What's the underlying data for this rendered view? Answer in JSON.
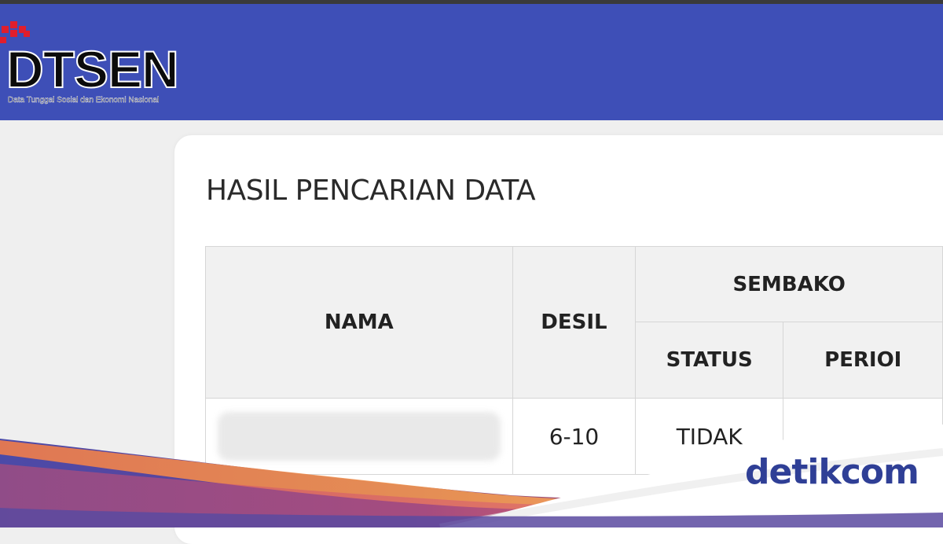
{
  "header": {
    "logo_text": "DTSEN",
    "logo_subtitle": "Data Tunggal Sosial dan Ekonomi Nasional",
    "color": "#3e4fb7"
  },
  "main": {
    "title": "HASIL PENCARIAN DATA",
    "table": {
      "columns": {
        "nama": "NAMA",
        "desil": "DESIL",
        "group": "SEMBAKO",
        "status": "STATUS",
        "periode": "PERIOI"
      },
      "rows": [
        {
          "nama": "",
          "desil": "6-10",
          "status": "TIDAK",
          "periode": ""
        }
      ]
    }
  },
  "watermark": {
    "text": "detikcom"
  }
}
